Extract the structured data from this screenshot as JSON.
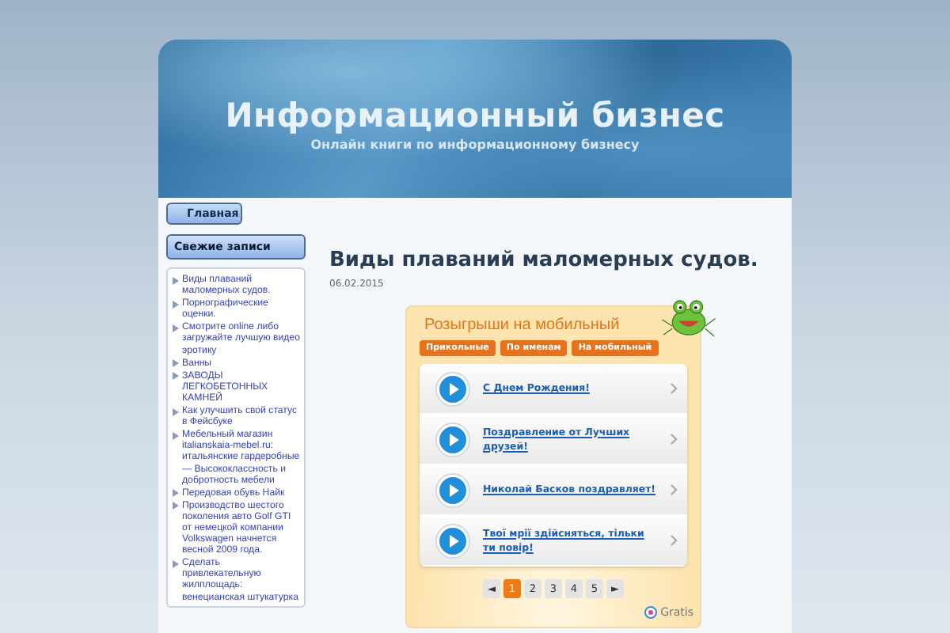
{
  "header": {
    "title": "Информационный бизнес",
    "tagline": "Онлайн книги по информационному бизнесу"
  },
  "nav": [
    {
      "label": "Главная",
      "selected": true
    }
  ],
  "sidebar": {
    "heading": "Свежие записи",
    "items": [
      "Виды плаваний маломерных судов.",
      "Порнографические оценки.",
      "Смотрите online либо загружайте лучшую видео эротику",
      "Ванны",
      "ЗАВОДЫ ЛЕГКОБЕТОННЫХ КАМНЕЙ",
      "Как улучшить свой статус в Фейсбуке",
      "Мебельный магазин italianskaia-mebel.ru: итальянские гардеробные — Высококлассность и добротность мебели",
      "Передовая обувь Найк",
      "Производство шестого поколения авто Golf GTI от немецкой компании Volkswagen начнется весной 2009 года.",
      "Сделать привлекательную жилплощадь: венецианская штукатурка"
    ]
  },
  "post": {
    "title": "Виды плаваний маломерных судов.",
    "date": "06.02.2015"
  },
  "widget": {
    "title": "Розыгрыши на мобильный",
    "tabs": [
      {
        "label": "Прикольные"
      },
      {
        "label": "По именам"
      },
      {
        "label": "На мобильный"
      }
    ],
    "items": [
      "С Днем Рождения!",
      "Поздравление от Лучших друзей!",
      "Николай Басков поздравляет!",
      "Твої мрії здійсняться, тільки ти повір!"
    ],
    "pager": {
      "prev": "◄",
      "pages": [
        {
          "label": "1",
          "selected": true
        },
        {
          "label": "2",
          "selected": false
        },
        {
          "label": "3",
          "selected": false
        },
        {
          "label": "4",
          "selected": false
        },
        {
          "label": "5",
          "selected": false
        }
      ],
      "next": "►"
    },
    "brand": "Gratis"
  }
}
